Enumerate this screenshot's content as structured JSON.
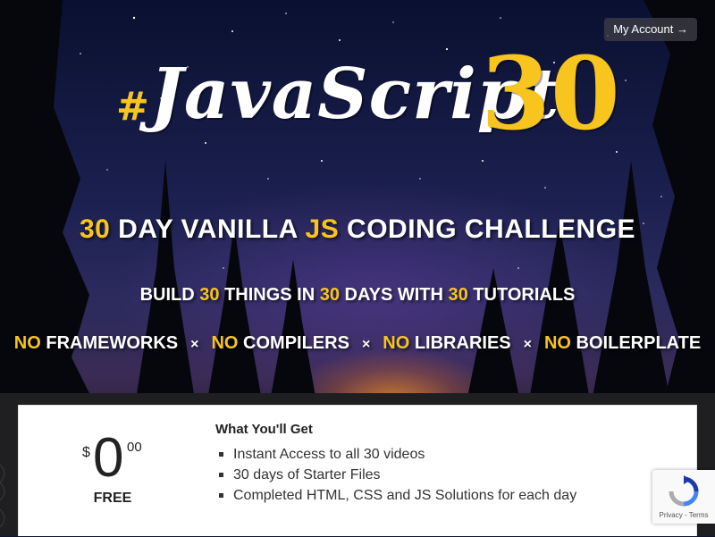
{
  "header": {
    "account_button": "My Account →"
  },
  "logo": {
    "hash": "#",
    "word": "JavaScript",
    "number": "30"
  },
  "headline": {
    "part1": "30",
    "part2": " DAY VANILLA ",
    "part3": "JS",
    "part4": " CODING CHALLENGE"
  },
  "subline": {
    "p1": "BUILD ",
    "n1": "30",
    "p2": " THINGS IN ",
    "n2": "30",
    "p3": " DAYS WITH ",
    "n3": "30",
    "p4": " TUTORIALS"
  },
  "no_row": {
    "no": "NO",
    "separator": "×",
    "items": [
      "FRAMEWORKS",
      "COMPILERS",
      "LIBRARIES",
      "BOILERPLATE"
    ]
  },
  "pricing": {
    "currency": "$",
    "amount": "0",
    "cents": "00",
    "label": "FREE",
    "features_title": "What You'll Get",
    "features": [
      "Instant Access to all 30 videos",
      "30 days of Starter Files",
      "Completed HTML, CSS and JS Solutions for each day"
    ]
  },
  "recaptcha": {
    "links": "Privacy - Terms",
    "icon": "recaptcha-icon"
  },
  "colors": {
    "accent": "#f7c51e",
    "sky_top": "#0a1030",
    "card": "#ffffff"
  }
}
